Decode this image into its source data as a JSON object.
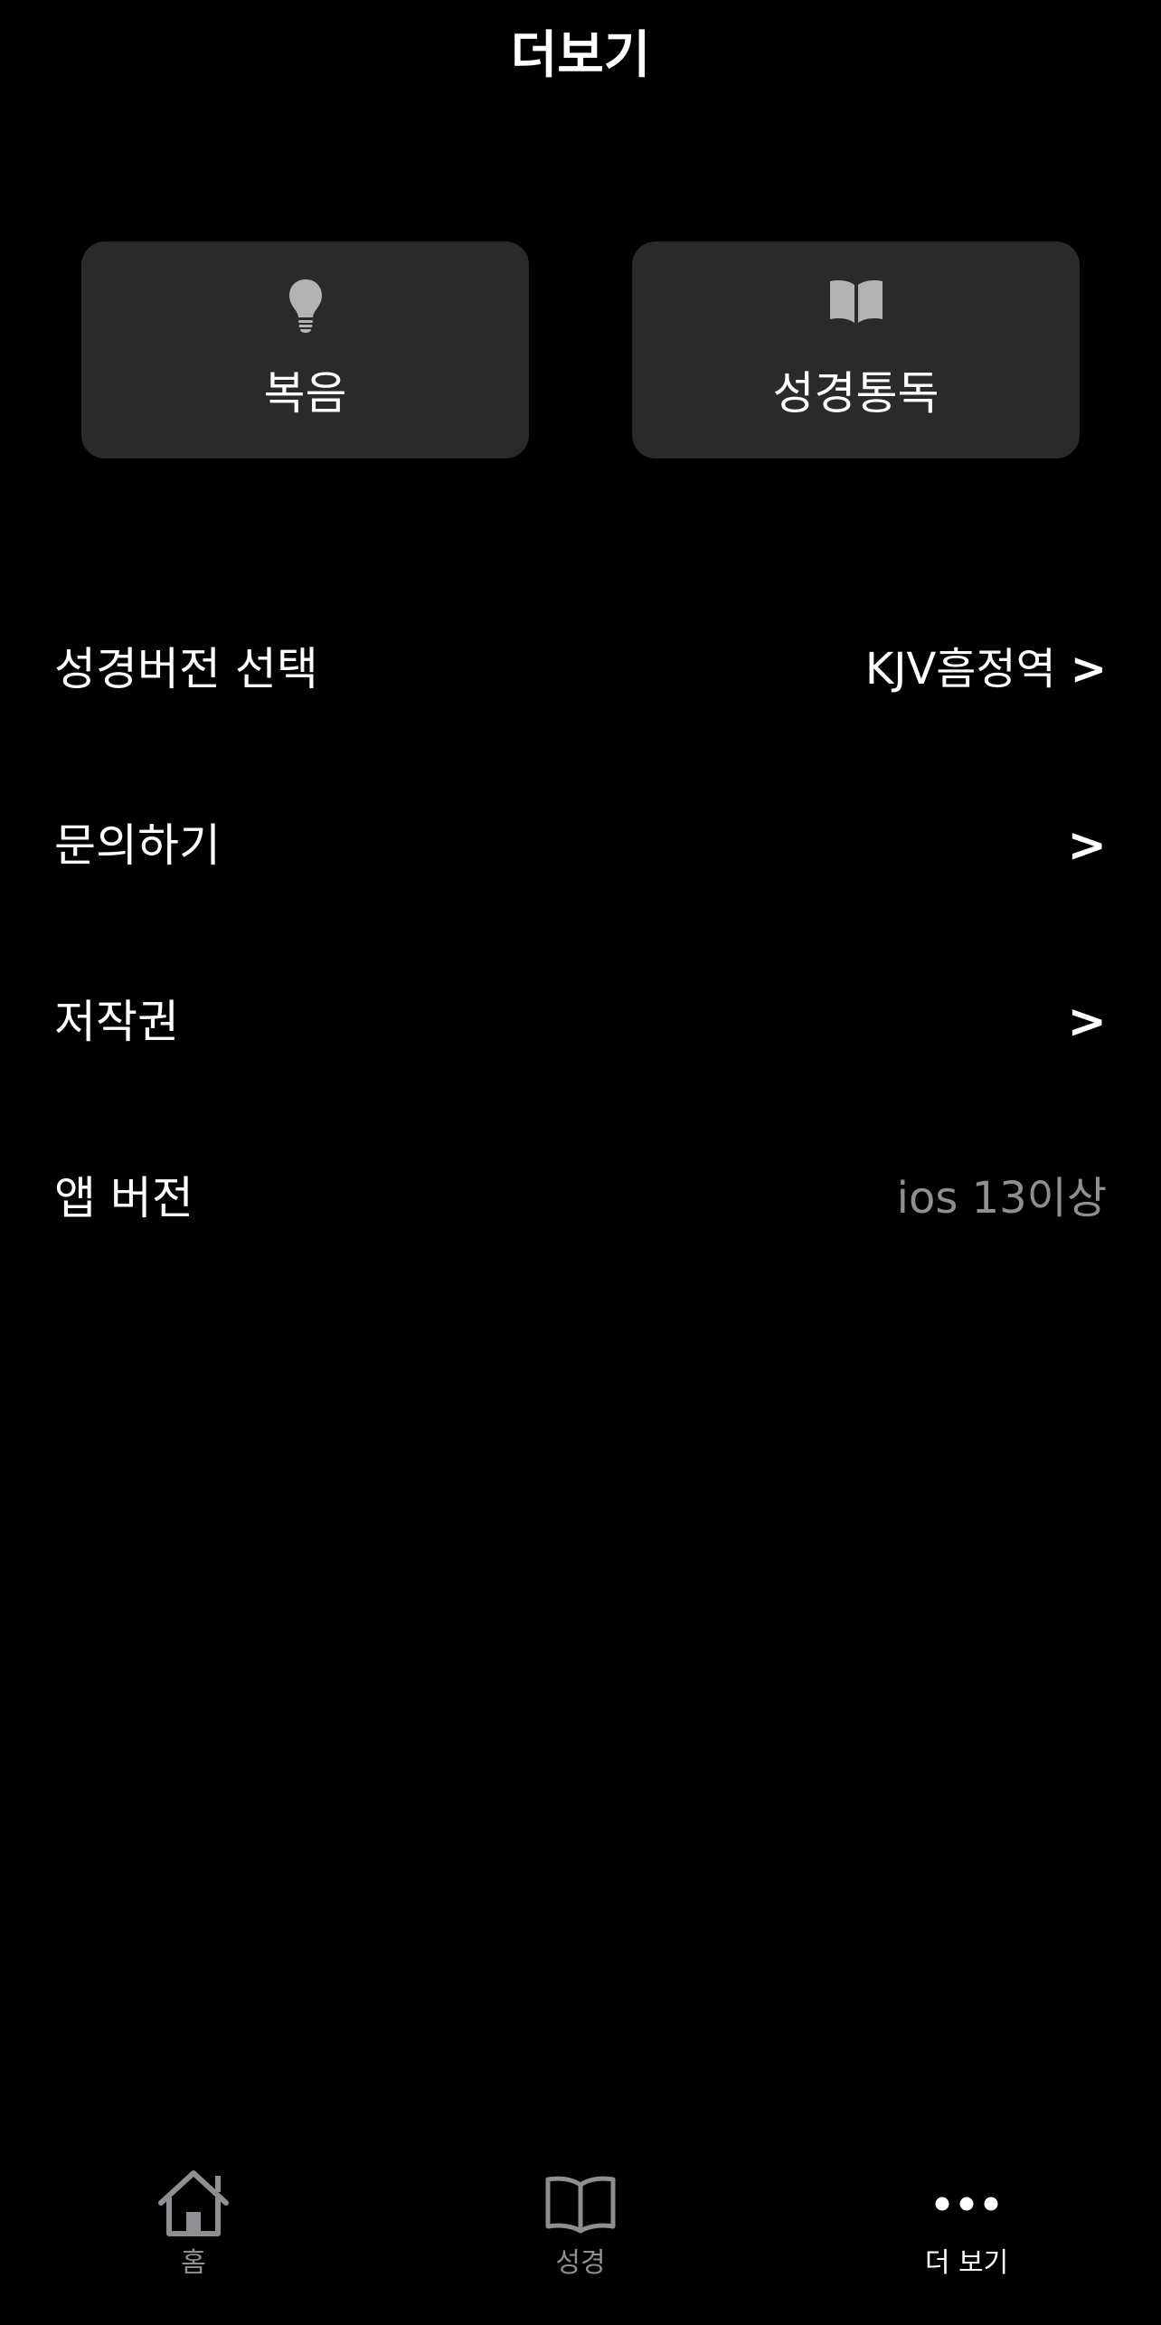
{
  "header": {
    "title": "더보기"
  },
  "cards": [
    {
      "label": "복음",
      "icon": "lightbulb-icon"
    },
    {
      "label": "성경통독",
      "icon": "open-book-icon"
    }
  ],
  "settings": {
    "bible_version": {
      "label": "성경버전 선택",
      "value": "KJV흠정역",
      "chevron": ">"
    },
    "inquiry": {
      "label": "문의하기",
      "chevron": ">"
    },
    "copyright": {
      "label": "저작권",
      "chevron": ">"
    },
    "app_version": {
      "label": "앱 버전",
      "value": "ios 13이상"
    }
  },
  "tabbar": {
    "items": [
      {
        "label": "홈",
        "icon": "home-icon",
        "active": false
      },
      {
        "label": "성경",
        "icon": "book-icon",
        "active": false
      },
      {
        "label": "더 보기",
        "icon": "more-dots-icon",
        "active": true
      }
    ]
  },
  "colors": {
    "background": "#000000",
    "card": "#2a2a2c",
    "muted": "#8e8e93",
    "icon": "#b3b3b3"
  }
}
